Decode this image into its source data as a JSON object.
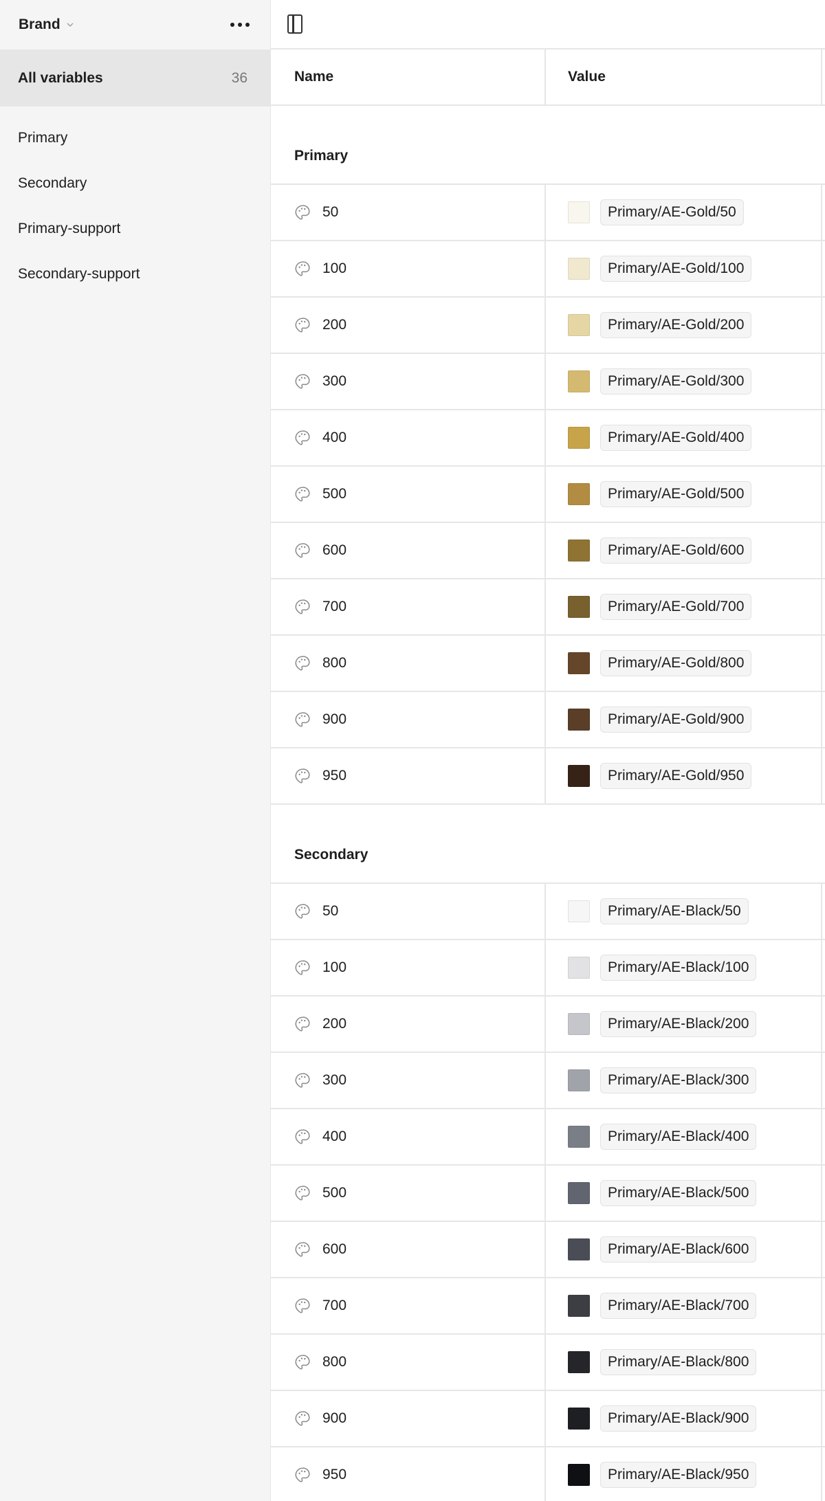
{
  "sidebar": {
    "collection_name": "Brand",
    "all_variables_label": "All variables",
    "all_variables_count": "36",
    "groups": [
      "Primary",
      "Secondary",
      "Primary-support",
      "Secondary-support"
    ]
  },
  "table": {
    "headers": {
      "name": "Name",
      "value": "Value"
    },
    "groups": [
      {
        "title": "Primary",
        "rows": [
          {
            "name": "50",
            "alias": "Primary/AE-Gold/50",
            "color": "#F9F6EE"
          },
          {
            "name": "100",
            "alias": "Primary/AE-Gold/100",
            "color": "#F0E8CF"
          },
          {
            "name": "200",
            "alias": "Primary/AE-Gold/200",
            "color": "#E5D6A3"
          },
          {
            "name": "300",
            "alias": "Primary/AE-Gold/300",
            "color": "#D4BA70"
          },
          {
            "name": "400",
            "alias": "Primary/AE-Gold/400",
            "color": "#C7A44A"
          },
          {
            "name": "500",
            "alias": "Primary/AE-Gold/500",
            "color": "#B28C42"
          },
          {
            "name": "600",
            "alias": "Primary/AE-Gold/600",
            "color": "#8E7333"
          },
          {
            "name": "700",
            "alias": "Primary/AE-Gold/700",
            "color": "#78602F"
          },
          {
            "name": "800",
            "alias": "Primary/AE-Gold/800",
            "color": "#66462A"
          },
          {
            "name": "900",
            "alias": "Primary/AE-Gold/900",
            "color": "#5A3E28"
          },
          {
            "name": "950",
            "alias": "Primary/AE-Gold/950",
            "color": "#372217"
          }
        ]
      },
      {
        "title": "Secondary",
        "rows": [
          {
            "name": "50",
            "alias": "Primary/AE-Black/50",
            "color": "#F6F6F6"
          },
          {
            "name": "100",
            "alias": "Primary/AE-Black/100",
            "color": "#E2E2E4"
          },
          {
            "name": "200",
            "alias": "Primary/AE-Black/200",
            "color": "#C5C6CB"
          },
          {
            "name": "300",
            "alias": "Primary/AE-Black/300",
            "color": "#A1A3AA"
          },
          {
            "name": "400",
            "alias": "Primary/AE-Black/400",
            "color": "#7A7E86"
          },
          {
            "name": "500",
            "alias": "Primary/AE-Black/500",
            "color": "#61656F"
          },
          {
            "name": "600",
            "alias": "Primary/AE-Black/600",
            "color": "#4B4D56"
          },
          {
            "name": "700",
            "alias": "Primary/AE-Black/700",
            "color": "#3D3E44"
          },
          {
            "name": "800",
            "alias": "Primary/AE-Black/800",
            "color": "#25262A"
          },
          {
            "name": "900",
            "alias": "Primary/AE-Black/900",
            "color": "#1E1F23"
          },
          {
            "name": "950",
            "alias": "Primary/AE-Black/950",
            "color": "#0F1014"
          }
        ]
      }
    ]
  }
}
